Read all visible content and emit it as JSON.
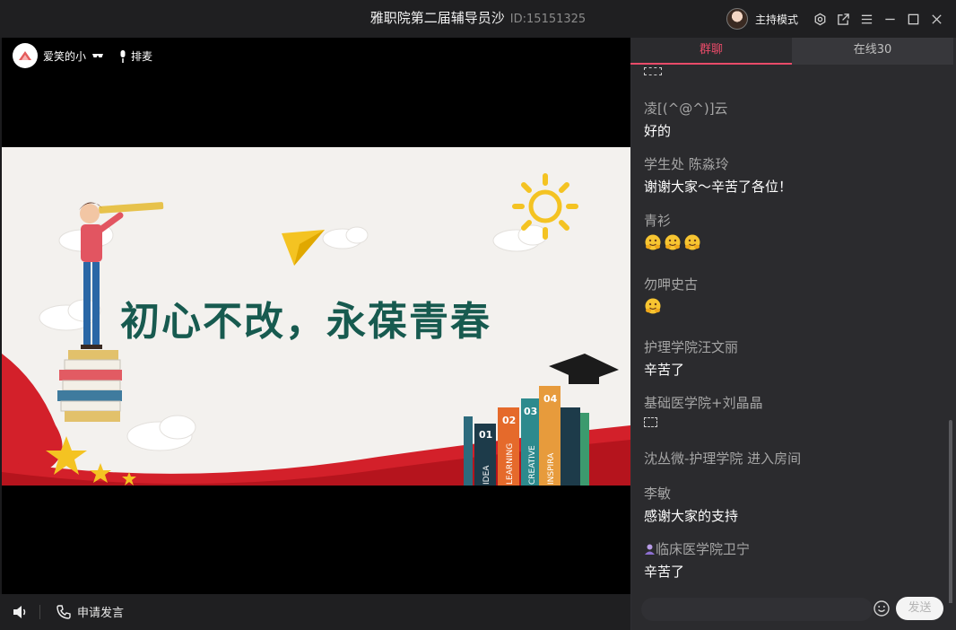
{
  "window": {
    "title": "雅职院第二届辅导员沙",
    "room_id": "ID:15151325",
    "host_mode_label": "主持模式"
  },
  "video": {
    "presenter_name": "爱笑的小",
    "queue_label": "排麦",
    "slide_title": "初心不改，永葆青春",
    "book_numbers": [
      "01",
      "02",
      "03",
      "04"
    ],
    "book_words": [
      "IDEA",
      "LEARNING",
      "CREATIVE",
      "INSPIRA"
    ]
  },
  "bottom_bar": {
    "request_speak_label": "申请发言"
  },
  "chat": {
    "tabs": [
      {
        "label": "群聊",
        "active": true
      },
      {
        "label": "在线30",
        "active": false
      }
    ],
    "messages": [
      {
        "name": "凌[(^@^)]云",
        "text": "好的"
      },
      {
        "name": "学生处 陈淼玲",
        "text": "谢谢大家～辛苦了各位！"
      },
      {
        "name": "青衫",
        "emoji_count": 3
      },
      {
        "name": "勿呷史古",
        "emoji_count": 1
      },
      {
        "name": "护理学院汪文丽",
        "text": "辛苦了"
      },
      {
        "name": "基础医学院+刘晶晶",
        "tofu": true
      },
      {
        "system": "沈丛微-护理学院 进入房间"
      },
      {
        "name": "李敏",
        "text": "感谢大家的支持"
      },
      {
        "name": "临床医学院卫宁",
        "text": "辛苦了",
        "badge": true
      }
    ],
    "send_label": "发送",
    "accent_color": "#e94b69"
  }
}
